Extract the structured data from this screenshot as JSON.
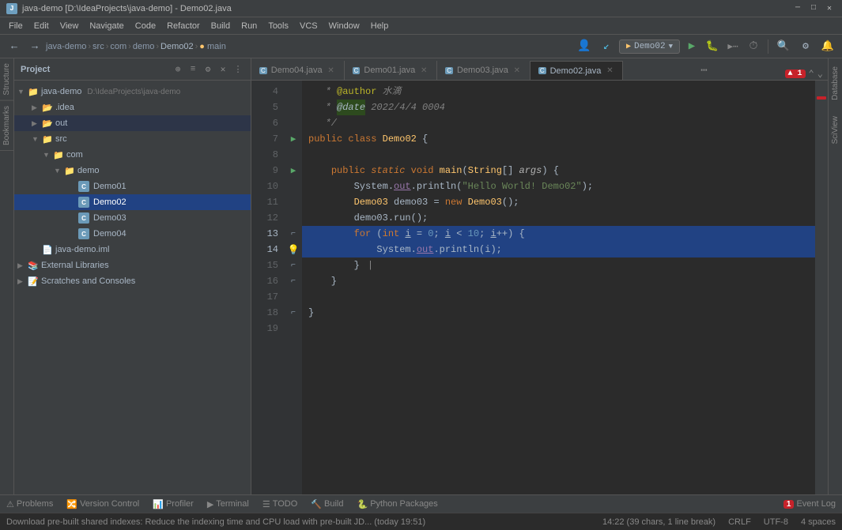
{
  "titleBar": {
    "projectPath": "java-demo [D:\\IdeaProjects\\java-demo] - Demo02.java",
    "controls": [
      "minimize",
      "maximize",
      "close"
    ]
  },
  "menuBar": {
    "items": [
      "File",
      "Edit",
      "View",
      "Navigate",
      "Code",
      "Refactor",
      "Build",
      "Run",
      "Tools",
      "VCS",
      "Window",
      "Help"
    ]
  },
  "toolbar": {
    "breadcrumb": [
      "java-demo",
      "src",
      "com",
      "demo",
      "Demo02",
      "main"
    ],
    "runConfig": "Demo02",
    "searchIcon": "🔍",
    "settingsIcon": "⚙",
    "notifIcon": "🔔"
  },
  "projectPanel": {
    "title": "Project",
    "tree": [
      {
        "id": "java-demo-root",
        "label": "java-demo",
        "path": "D:\\IdeaProjects\\java-demo",
        "indent": 0,
        "type": "module",
        "expanded": true
      },
      {
        "id": "idea-folder",
        "label": ".idea",
        "indent": 1,
        "type": "folder",
        "expanded": false
      },
      {
        "id": "out-folder",
        "label": "out",
        "indent": 1,
        "type": "folder",
        "expanded": false,
        "selected_highlight": true
      },
      {
        "id": "src-folder",
        "label": "src",
        "indent": 1,
        "type": "folder",
        "expanded": true
      },
      {
        "id": "com-folder",
        "label": "com",
        "indent": 2,
        "type": "folder",
        "expanded": true
      },
      {
        "id": "demo-folder",
        "label": "demo",
        "indent": 3,
        "type": "folder",
        "expanded": true
      },
      {
        "id": "Demo01",
        "label": "Demo01",
        "indent": 4,
        "type": "java"
      },
      {
        "id": "Demo02",
        "label": "Demo02",
        "indent": 4,
        "type": "java",
        "selected": true
      },
      {
        "id": "Demo03",
        "label": "Demo03",
        "indent": 4,
        "type": "java"
      },
      {
        "id": "Demo04",
        "label": "Demo04",
        "indent": 4,
        "type": "java"
      },
      {
        "id": "iml-file",
        "label": "java-demo.iml",
        "indent": 1,
        "type": "iml"
      },
      {
        "id": "ext-libs",
        "label": "External Libraries",
        "indent": 0,
        "type": "library",
        "expanded": false
      },
      {
        "id": "scratches",
        "label": "Scratches and Consoles",
        "indent": 0,
        "type": "scratch",
        "expanded": false
      }
    ]
  },
  "tabs": [
    {
      "id": "Demo04",
      "label": "Demo04.java",
      "active": false
    },
    {
      "id": "Demo01",
      "label": "Demo01.java",
      "active": false
    },
    {
      "id": "Demo03",
      "label": "Demo03.java",
      "active": false
    },
    {
      "id": "Demo02",
      "label": "Demo02.java",
      "active": true
    }
  ],
  "codeLines": [
    {
      "num": 4,
      "content": "   * @author 水滴",
      "type": "comment-author"
    },
    {
      "num": 5,
      "content": "   * @date 2022/4/4 0004",
      "type": "comment-date"
    },
    {
      "num": 6,
      "content": "   */",
      "type": "comment-end"
    },
    {
      "num": 7,
      "content": "public class Demo02 {",
      "type": "code"
    },
    {
      "num": 8,
      "content": "",
      "type": "empty"
    },
    {
      "num": 9,
      "content": "    public static void main(String[] args) {",
      "type": "code"
    },
    {
      "num": 10,
      "content": "        System.out.println(\"Hello World! Demo02\");",
      "type": "code"
    },
    {
      "num": 11,
      "content": "        Demo03 demo03 = new Demo03();",
      "type": "code"
    },
    {
      "num": 12,
      "content": "        demo03.run();",
      "type": "code"
    },
    {
      "num": 13,
      "content": "        for (int i = 0; i < 10; i++) {",
      "type": "code",
      "highlighted": true
    },
    {
      "num": 14,
      "content": "            System.out.println(i);",
      "type": "code",
      "highlighted": true
    },
    {
      "num": 15,
      "content": "        }",
      "type": "code",
      "highlighted": false
    },
    {
      "num": 16,
      "content": "    }",
      "type": "code"
    },
    {
      "num": 17,
      "content": "",
      "type": "empty"
    },
    {
      "num": 18,
      "content": "}",
      "type": "code"
    },
    {
      "num": 19,
      "content": "",
      "type": "empty"
    }
  ],
  "statusBar": {
    "cursorPos": "14:22 (39 chars, 1 line break)",
    "lineEnding": "CRLF",
    "encoding": "UTF-8",
    "indent": "4 spaces",
    "errorCount": "1",
    "eventLog": "Event Log"
  },
  "bottomTabs": [
    {
      "id": "problems",
      "label": "Problems",
      "icon": "⚠"
    },
    {
      "id": "versionControl",
      "label": "Version Control",
      "icon": "🔀"
    },
    {
      "id": "profiler",
      "label": "Profiler",
      "icon": "📊"
    },
    {
      "id": "terminal",
      "label": "Terminal",
      "icon": "▶"
    },
    {
      "id": "todo",
      "label": "TODO",
      "icon": "☰"
    },
    {
      "id": "build",
      "label": "Build",
      "icon": "🔨"
    },
    {
      "id": "python",
      "label": "Python Packages",
      "icon": "📦"
    }
  ],
  "infoBar": {
    "text": "Download pre-built shared indexes: Reduce the indexing time and CPU load with pre-built JD... (today 19:51)"
  },
  "rightPanelTabs": [
    "Database",
    "SciView"
  ],
  "leftPanelTabs": [
    "Structure",
    "Bookmarks"
  ]
}
